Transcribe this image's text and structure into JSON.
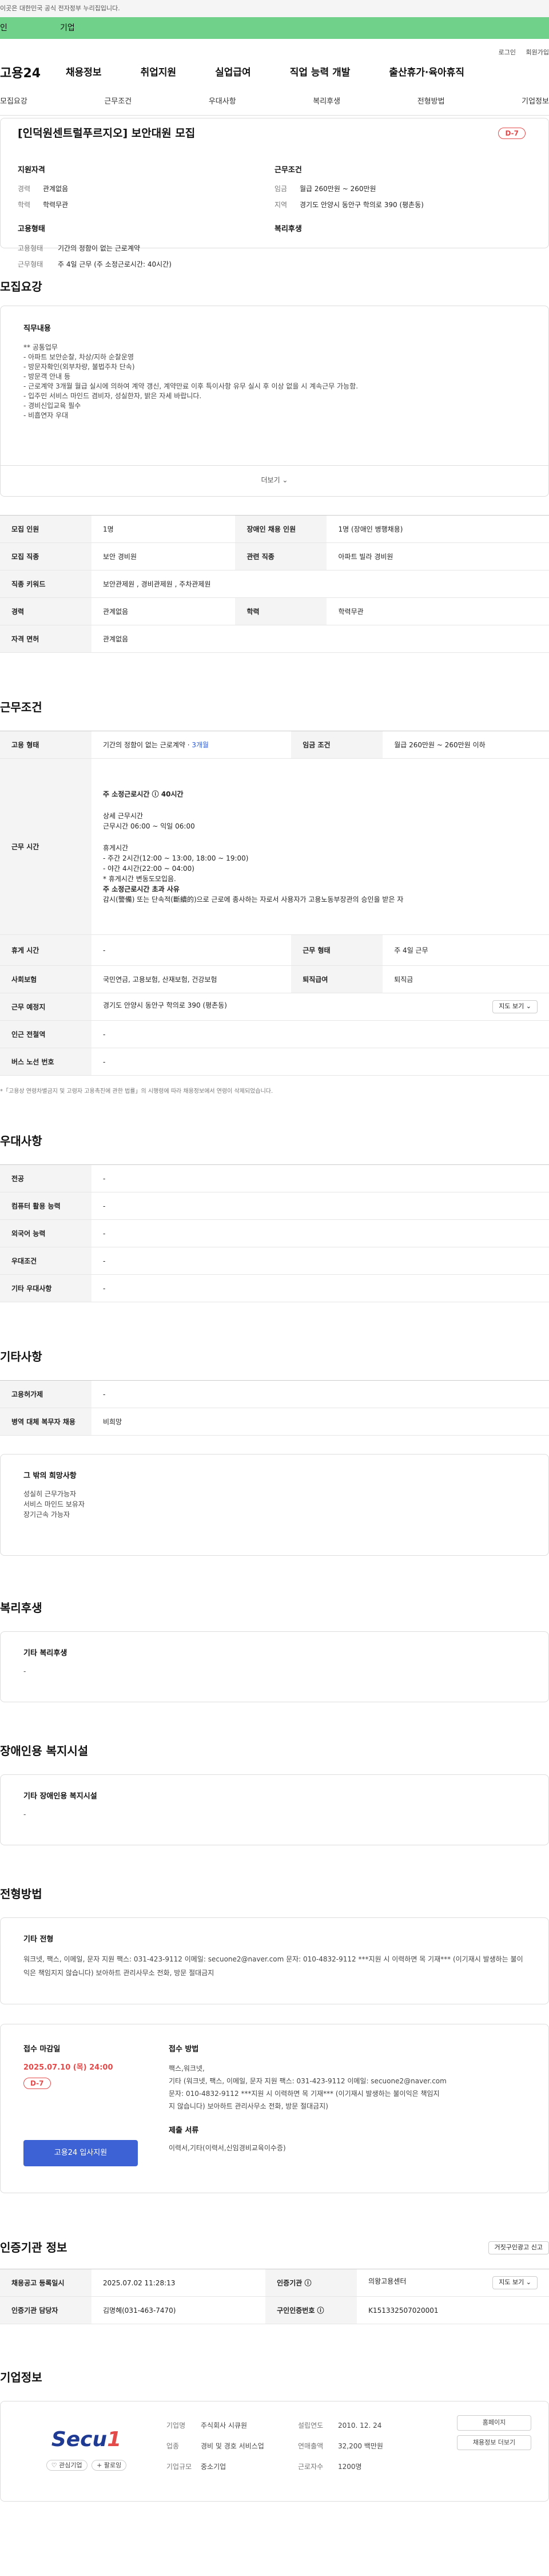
{
  "top_notice": "이곳은 대한민국 공식 전자정부 누리집입니다.",
  "green_bar": {
    "left": "인",
    "right": "기업"
  },
  "util": {
    "login": "로그인",
    "join": "회원가입"
  },
  "gnb": {
    "logo": "고용24",
    "menu": [
      "채용정보",
      "취업지원",
      "실업급여",
      "직업 능력 개발",
      "출산휴가·육아휴직"
    ]
  },
  "tabs": [
    "모집요강",
    "근무조건",
    "우대사항",
    "복리후생",
    "전형방법",
    "기업정보"
  ],
  "job": {
    "title": "[인덕원센트럴푸르지오] 보안대원 모집",
    "dday": "D-7",
    "qual_title": "지원자격",
    "qual": [
      {
        "k": "경력",
        "v": "관계없음"
      },
      {
        "k": "학력",
        "v": "학력무관"
      }
    ],
    "emp_title": "고용형태",
    "emp": [
      {
        "k": "고용형태",
        "v": "기간의 정함이 없는 근로계약"
      },
      {
        "k": "근무형태",
        "v": "주 4일 근무 (주 소정근로시간: 40시간)"
      }
    ],
    "cond_title": "근무조건",
    "cond": [
      {
        "k": "임금",
        "v": "월급 260만원 ~ 260만원"
      },
      {
        "k": "지역",
        "v": "경기도 안양시 동안구 학의로 390 (평촌동)"
      }
    ],
    "welfare_title": "복리후생"
  },
  "sec_recruit": "모집요강",
  "desc": {
    "title": "직무내용",
    "lines": [
      "** 공통업무",
      "- 아파트 보안순찰, 차상/지하 순찰운영",
      "- 방문자확인(외부차량, 불법주차 단속)",
      "- 방문객 안내 등",
      "- 근로계약 3개월 월급 실시에 의하여 계약 갱신, 계약만료 이후 특이사항 유무 실시 후 이상 없을 시 계속근무 가능함.",
      "- 입주민 서비스 마인드 겸비자, 성실한자, 밝은 자세 바랍니다.",
      "- 경비신입교육 필수",
      "- 비흡연자 우대"
    ],
    "more": "더보기 ⌄"
  },
  "recruit_table": [
    [
      "모집 인원",
      "1명",
      "장애인 채용 인원",
      "1명 (장애인 병행채용)"
    ],
    [
      "모집 직종",
      "보안 경비원",
      "관련 직종",
      "아파트 빌라 경비원"
    ],
    [
      "직종 키워드",
      "보안관제원 , 경비관제원 , 주차관제원",
      "",
      ""
    ],
    [
      "경력",
      "관계없음",
      "학력",
      "학력무관"
    ],
    [
      "자격 면허",
      "관계없음",
      "",
      ""
    ]
  ],
  "sec_cond": "근무조건",
  "cond_table": {
    "emp_type_h": "고용 형태",
    "emp_type_v": "기간의 정함이 없는 근로계약 · ",
    "emp_type_link": "3개월",
    "wage_h": "임금 조건",
    "wage_v": "월급 260만원 ~ 260만원 이하",
    "hours_h": "근무 시간",
    "hours_lines": [
      "주 소정근로시간 ⓘ 40시간",
      "",
      "상세 근무시간",
      "근무시간 06:00 ~ 익일 06:00",
      "",
      "휴게시간",
      "- 주간 2시간(12:00 ~ 13:00, 18:00 ~ 19:00)",
      "- 야간 4시간(22:00 ~ 04:00)",
      "* 휴게시간 변동도모입음.",
      "주 소정근로시간 초과 사유",
      "감시(警備) 또는 단속적(斷續的)으로 근로에 종사하는 자로서 사용자가 고용노동부장관의 승인을 받은 자"
    ],
    "rest_h": "휴게 시간",
    "rest_v": "-",
    "work_type_h": "근무 형태",
    "work_type_v": "주 4일 근무",
    "insure_h": "사회보험",
    "insure_v": "국민연금, 고용보험, 산재보험, 건강보험",
    "retire_h": "퇴직급여",
    "retire_v": "퇴직금",
    "place_h": "근무 예정지",
    "place_v": "경기도 안양시 동안구 학의로 390 (평촌동)",
    "map_btn": "지도 보기 ⌄",
    "subway_h": "인근 전철역",
    "subway_v": "-",
    "bus_h": "버스 노선 번호",
    "bus_v": "-",
    "note": "*「고용상 연령차별금지 및 고령자 고용촉진에 관한 법률」의 시행령에 따라 채용정보에서 연령이 삭제되었습니다."
  },
  "sec_pref": "우대사항",
  "pref_table": [
    [
      "전공",
      "-"
    ],
    [
      "컴퓨터 활용 능력",
      "-"
    ],
    [
      "외국어 능력",
      "-"
    ],
    [
      "우대조건",
      "-"
    ],
    [
      "기타 우대사항",
      "-"
    ]
  ],
  "sec_etc": "기타사항",
  "etc_table": [
    [
      "고용허가제",
      "-"
    ],
    [
      "병역 대체 복무자 채용",
      "비희망"
    ]
  ],
  "etc_box": {
    "title": "그 밖의 희망사항",
    "lines": [
      "성실히 근무가능자",
      "서비스 마인드 보유자",
      "장기근속 가능자"
    ]
  },
  "sec_welfare": "복리후생",
  "welfare_box": {
    "title": "기타 복리후생",
    "value": "-"
  },
  "sec_disabled": "장애인용 복지시설",
  "disabled_box": {
    "title": "기타 장애인용 복지시설",
    "value": "-"
  },
  "sec_method": "전형방법",
  "method_box": {
    "title": "기타 전형",
    "text": "워크넷, 팩스, 이메일, 문자 지원 팩스: 031-423-9112 이메일: secuone2@naver.com 문자: 010-4832-9112 ***지원 시 이력하면 목 기재*** (이기재시 발생하는 불이익은 책임지지 않습니다) 보아하트 관리사무소 전화, 방문 절대금지"
  },
  "apply_box": {
    "deadline_h": "접수 마감일",
    "deadline": "2025.07.10 (목) 24:00",
    "dday": "D-7",
    "btn": "고용24 입사지원",
    "method_h": "접수 방법",
    "method_lines": [
      "팩스,워크넷,",
      "기타 (워크넷, 팩스, 이메일, 문자 지원 팩스: 031-423-9112 이메일: secuone2@naver.com",
      "문자: 010-4832-9112 ***지원 시 이력하면 목 기재*** (이기재시 발생하는 불이익은 책임지",
      "지 않습니다) 보아하트 관리사무소 전화, 방문 절대금지)"
    ],
    "docs_h": "제출 서류",
    "docs": "이력서,기타(이력서,신임경비교육이수증)"
  },
  "sec_auth": "인증기관 정보",
  "auth_btn": "거짓구인광고 신고",
  "auth_table": {
    "r1": [
      "채용공고 등록일시",
      "2025.07.02 11:28:13",
      "인증기관 ⓘ",
      "의왕고용센터"
    ],
    "r1_btn": "지도 보기 ⌄",
    "r2": [
      "인증기관 담당자",
      "김명혜(031-463-7470)",
      "구인인증번호 ⓘ",
      "K151332507020001"
    ]
  },
  "sec_company": "기업정보",
  "company": {
    "logo": "Secu",
    "fav": "♡ 관심기업",
    "follow": "+ 팔로잉",
    "rows": [
      [
        "기업명",
        "주식회사 시큐원",
        "설립연도",
        "2010. 12. 24"
      ],
      [
        "업종",
        "경비 및 경호 서비스업",
        "연매출액",
        "32,200 백만원"
      ],
      [
        "기업규모",
        "중소기업",
        "근로자수",
        "1200명"
      ]
    ],
    "btn_home": "홈페이지",
    "btn_jobs": "채용정보 더보기"
  }
}
